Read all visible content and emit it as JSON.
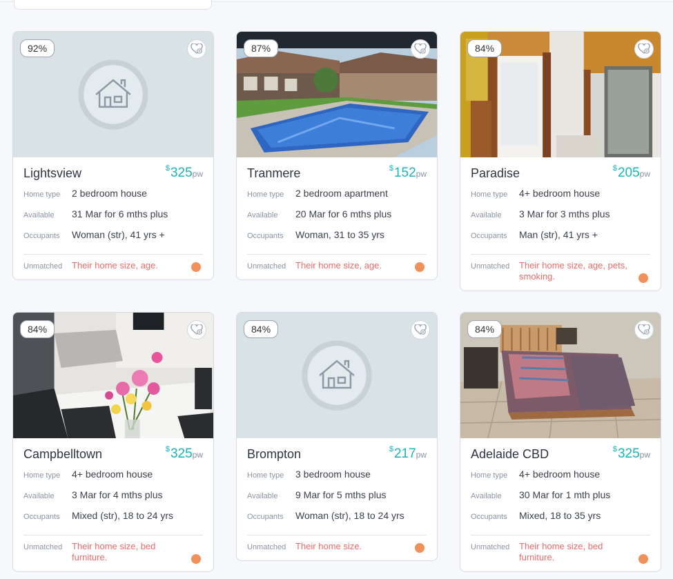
{
  "labels": {
    "home_type": "Home type",
    "available": "Available",
    "occupants": "Occupants",
    "unmatched": "Unmatched",
    "per_week": "pw",
    "currency": "$"
  },
  "colors": {
    "accent": "#1ab3b8",
    "unmatched_text": "#ee6a6a",
    "status_dot": "#f0915b"
  },
  "listings": [
    {
      "match": "92%",
      "suburb": "Lightsview",
      "price": "325",
      "home_type": "2 bedroom house",
      "available": "31 Mar for 6 mths plus",
      "occupants": "Woman (str), 41 yrs +",
      "unmatched": "Their home size, age.",
      "image": "placeholder-house-icon"
    },
    {
      "match": "87%",
      "suburb": "Tranmere",
      "price": "152",
      "home_type": "2 bedroom apartment",
      "available": "20 Mar for 6 mths plus",
      "occupants": "Woman, 31 to 35 yrs",
      "unmatched": "Their home size, age.",
      "image": "pool-photo"
    },
    {
      "match": "84%",
      "suburb": "Paradise",
      "price": "205",
      "home_type": "4+ bedroom house",
      "available": "3 Mar for 3 mths plus",
      "occupants": "Man (str), 41 yrs +",
      "unmatched": "Their home size, age, pets, smoking.",
      "image": "room-doorway-photo"
    },
    {
      "match": "84%",
      "suburb": "Campbelltown",
      "price": "325",
      "home_type": "4+ bedroom house",
      "available": "3 Mar for 4 mths plus",
      "occupants": "Mixed (str), 18 to 24 yrs",
      "unmatched": "Their home size, bed furniture.",
      "image": "dining-flowers-photo"
    },
    {
      "match": "84%",
      "suburb": "Brompton",
      "price": "217",
      "home_type": "3 bedroom house",
      "available": "9 Mar for 5 mths plus",
      "occupants": "Woman (str), 18 to 24 yrs",
      "unmatched": "Their home size.",
      "image": "placeholder-house-icon"
    },
    {
      "match": "84%",
      "suburb": "Adelaide CBD",
      "price": "325",
      "home_type": "4+ bedroom house",
      "available": "30 Mar for 1 mth plus",
      "occupants": "Mixed, 18 to 35 yrs",
      "unmatched": "Their home size, bed furniture.",
      "image": "bedroom-photo"
    }
  ]
}
